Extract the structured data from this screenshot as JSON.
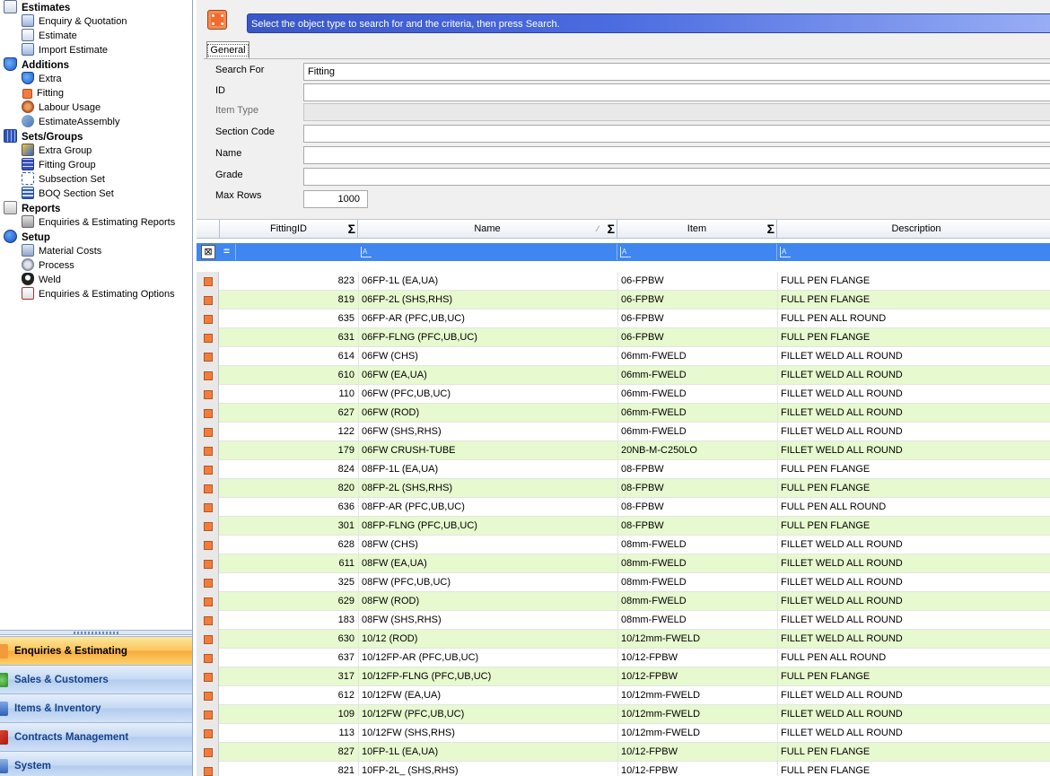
{
  "nav": {
    "tree": [
      {
        "type": "group",
        "label": "Estimates",
        "icon": "estimates-icon"
      },
      {
        "type": "item",
        "label": "Enquiry & Quotation",
        "icon": "enquiry-icon"
      },
      {
        "type": "item",
        "label": "Estimate",
        "icon": "estimate-icon"
      },
      {
        "type": "item",
        "label": "Import Estimate",
        "icon": "import-icon"
      },
      {
        "type": "group",
        "label": "Additions",
        "icon": "additions-icon"
      },
      {
        "type": "item",
        "label": "Extra",
        "icon": "extra-icon"
      },
      {
        "type": "item",
        "label": "Fitting",
        "icon": "fitting-icon"
      },
      {
        "type": "item",
        "label": "Labour Usage",
        "icon": "labour-icon"
      },
      {
        "type": "item",
        "label": "EstimateAssembly",
        "icon": "assembly-icon"
      },
      {
        "type": "group",
        "label": "Sets/Groups",
        "icon": "sets-icon"
      },
      {
        "type": "item",
        "label": "Extra Group",
        "icon": "extra-group-icon"
      },
      {
        "type": "item",
        "label": "Fitting Group",
        "icon": "fitting-group-icon"
      },
      {
        "type": "item",
        "label": "Subsection Set",
        "icon": "subsection-icon"
      },
      {
        "type": "item",
        "label": "BOQ Section Set",
        "icon": "boq-icon"
      },
      {
        "type": "group",
        "label": "Reports",
        "icon": "reports-icon"
      },
      {
        "type": "item",
        "label": "Enquiries & Estimating Reports",
        "icon": "printer-icon"
      },
      {
        "type": "group",
        "label": "Setup",
        "icon": "info-icon"
      },
      {
        "type": "item",
        "label": "Material Costs",
        "icon": "material-icon"
      },
      {
        "type": "item",
        "label": "Process",
        "icon": "process-icon"
      },
      {
        "type": "item",
        "label": "Weld",
        "icon": "weld-icon"
      },
      {
        "type": "item",
        "label": "Enquiries & Estimating Options",
        "icon": "options-icon"
      }
    ],
    "buttons": [
      {
        "label": "Enquiries & Estimating",
        "active": true
      },
      {
        "label": "Sales & Customers",
        "active": false
      },
      {
        "label": "Items & Inventory",
        "active": false
      },
      {
        "label": "Contracts Management",
        "active": false
      },
      {
        "label": "System",
        "active": false
      }
    ]
  },
  "search": {
    "banner": "Select the object type to search for and the criteria, then press Search.",
    "tab_label": "General",
    "fields": {
      "search_for": {
        "label": "Search For",
        "value": "Fitting"
      },
      "id": {
        "label": "ID",
        "value": ""
      },
      "item_type": {
        "label": "Item Type",
        "value": ""
      },
      "section_code": {
        "label": "Section Code",
        "value": ""
      },
      "name": {
        "label": "Name",
        "value": ""
      },
      "grade": {
        "label": "Grade",
        "value": ""
      },
      "max_rows": {
        "label": "Max Rows",
        "value": "1000"
      }
    }
  },
  "grid": {
    "columns": {
      "id": "FittingID",
      "name": "Name",
      "item": "Item",
      "description": "Description"
    },
    "filter_operator": "=",
    "rows": [
      {
        "id": "823",
        "name": "06FP-1L (EA,UA)",
        "item": "06-FPBW",
        "desc": "FULL PEN FLANGE"
      },
      {
        "id": "819",
        "name": "06FP-2L (SHS,RHS)",
        "item": "06-FPBW",
        "desc": "FULL PEN FLANGE"
      },
      {
        "id": "635",
        "name": "06FP-AR (PFC,UB,UC)",
        "item": "06-FPBW",
        "desc": "FULL PEN ALL ROUND"
      },
      {
        "id": "631",
        "name": "06FP-FLNG (PFC,UB,UC)",
        "item": "06-FPBW",
        "desc": "FULL PEN FLANGE"
      },
      {
        "id": "614",
        "name": "06FW (CHS)",
        "item": "06mm-FWELD",
        "desc": "FILLET WELD ALL ROUND"
      },
      {
        "id": "610",
        "name": "06FW (EA,UA)",
        "item": "06mm-FWELD",
        "desc": "FILLET WELD ALL ROUND"
      },
      {
        "id": "110",
        "name": "06FW (PFC,UB,UC)",
        "item": "06mm-FWELD",
        "desc": "FILLET WELD ALL ROUND"
      },
      {
        "id": "627",
        "name": "06FW (ROD)",
        "item": "06mm-FWELD",
        "desc": "FILLET WELD ALL ROUND"
      },
      {
        "id": "122",
        "name": "06FW (SHS,RHS)",
        "item": "06mm-FWELD",
        "desc": "FILLET WELD ALL ROUND"
      },
      {
        "id": "179",
        "name": "06FW CRUSH-TUBE",
        "item": "20NB-M-C250LO",
        "desc": "FILLET WELD ALL ROUND"
      },
      {
        "id": "824",
        "name": "08FP-1L (EA,UA)",
        "item": "08-FPBW",
        "desc": "FULL PEN FLANGE"
      },
      {
        "id": "820",
        "name": "08FP-2L (SHS,RHS)",
        "item": "08-FPBW",
        "desc": "FULL PEN FLANGE"
      },
      {
        "id": "636",
        "name": "08FP-AR (PFC,UB,UC)",
        "item": "08-FPBW",
        "desc": "FULL PEN ALL ROUND"
      },
      {
        "id": "301",
        "name": "08FP-FLNG (PFC,UB,UC)",
        "item": "08-FPBW",
        "desc": "FULL PEN FLANGE"
      },
      {
        "id": "628",
        "name": "08FW (CHS)",
        "item": "08mm-FWELD",
        "desc": "FILLET WELD ALL ROUND"
      },
      {
        "id": "611",
        "name": "08FW (EA,UA)",
        "item": "08mm-FWELD",
        "desc": "FILLET WELD ALL ROUND"
      },
      {
        "id": "325",
        "name": "08FW (PFC,UB,UC)",
        "item": "08mm-FWELD",
        "desc": "FILLET WELD ALL ROUND"
      },
      {
        "id": "629",
        "name": "08FW (ROD)",
        "item": "08mm-FWELD",
        "desc": "FILLET WELD ALL ROUND"
      },
      {
        "id": "183",
        "name": "08FW (SHS,RHS)",
        "item": "08mm-FWELD",
        "desc": "FILLET WELD ALL ROUND"
      },
      {
        "id": "630",
        "name": "10/12 (ROD)",
        "item": "10/12mm-FWELD",
        "desc": "FILLET WELD ALL ROUND"
      },
      {
        "id": "637",
        "name": "10/12FP-AR (PFC,UB,UC)",
        "item": "10/12-FPBW",
        "desc": "FULL PEN ALL ROUND"
      },
      {
        "id": "317",
        "name": "10/12FP-FLNG (PFC,UB,UC)",
        "item": "10/12-FPBW",
        "desc": "FULL PEN FLANGE"
      },
      {
        "id": "612",
        "name": "10/12FW (EA,UA)",
        "item": "10/12mm-FWELD",
        "desc": "FILLET WELD ALL ROUND"
      },
      {
        "id": "109",
        "name": "10/12FW (PFC,UB,UC)",
        "item": "10/12mm-FWELD",
        "desc": "FILLET WELD ALL ROUND"
      },
      {
        "id": "113",
        "name": "10/12FW (SHS,RHS)",
        "item": "10/12mm-FWELD",
        "desc": "FILLET WELD ALL ROUND"
      },
      {
        "id": "827",
        "name": "10FP-1L (EA,UA)",
        "item": "10/12-FPBW",
        "desc": "FULL PEN FLANGE"
      },
      {
        "id": "821",
        "name": "10FP-2L_ (SHS,RHS)",
        "item": "10/12-FPBW",
        "desc": "FULL PEN FLANGE"
      }
    ]
  }
}
